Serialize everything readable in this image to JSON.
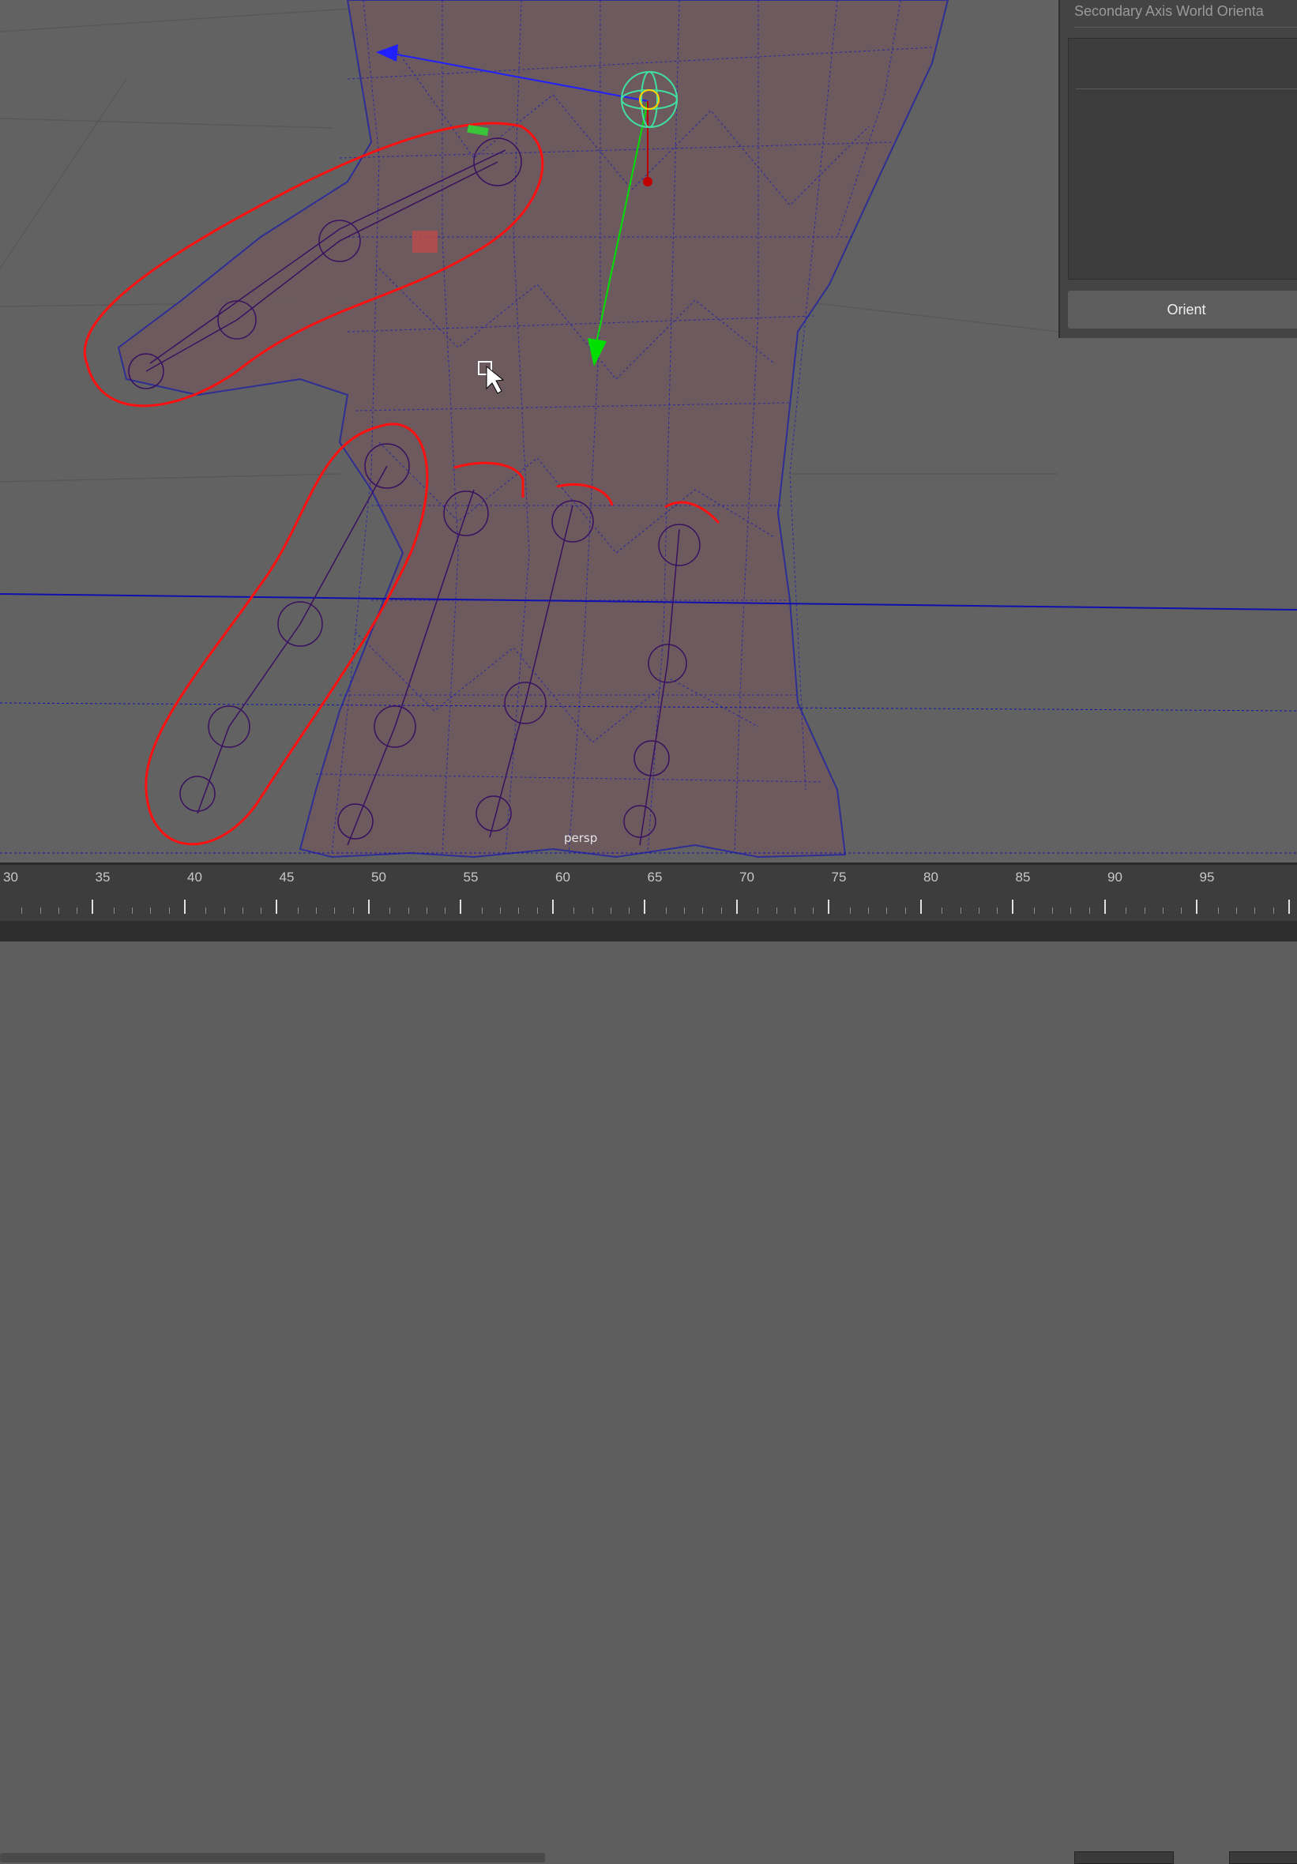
{
  "viewport": {
    "camera_label": "persp"
  },
  "joint_orient_panel": {
    "secondary_axis_label": "Secondary Axis World Orienta",
    "orient_button": "Orient"
  },
  "timeline": {
    "ticks": [
      "30",
      "35",
      "40",
      "45",
      "50",
      "55",
      "60",
      "65",
      "70",
      "75",
      "80",
      "85",
      "90",
      "95"
    ]
  },
  "colors": {
    "viewport_bg": "#626262",
    "wireframe": "#1a1a9a",
    "annotation": "#ff1010",
    "manipulator_x": "#2020ff",
    "manipulator_y": "#00e000",
    "manipulator_z": "#d00000"
  }
}
